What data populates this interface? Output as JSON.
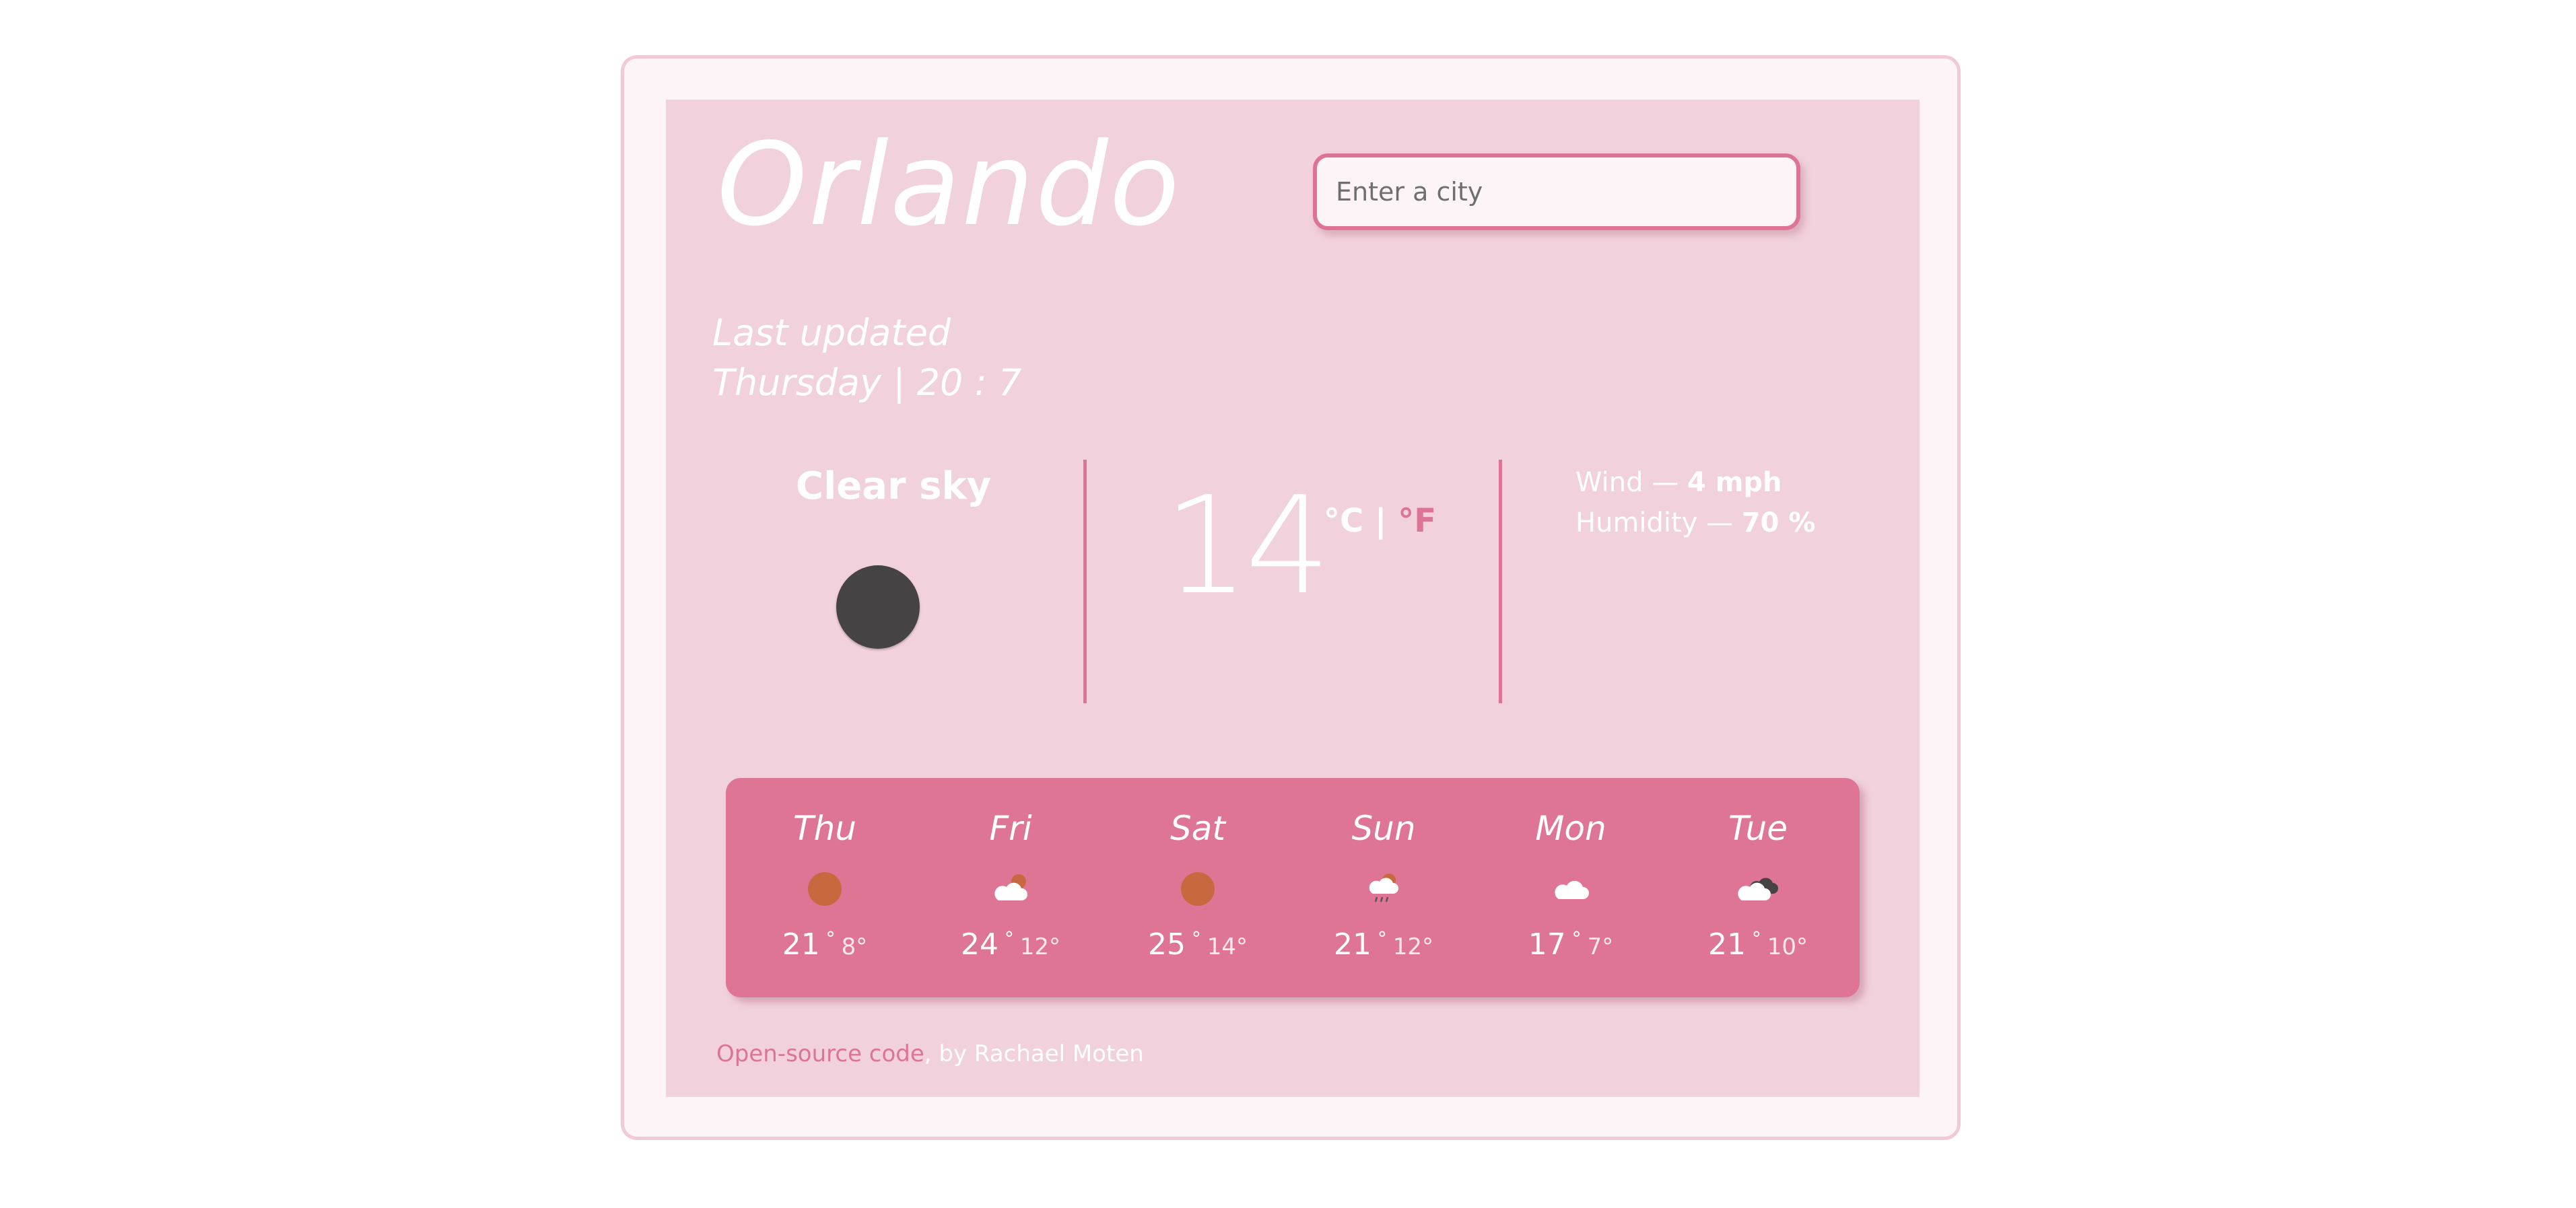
{
  "city": "Orlando",
  "search": {
    "placeholder": "Enter a city"
  },
  "updated": {
    "label": "Last updated",
    "value": "Thursday | 20 : 7"
  },
  "current": {
    "description": "Clear sky",
    "icon": "dark-circle-icon",
    "temperature": "14",
    "unit_c": "°C",
    "separator": " | ",
    "unit_f": "°F",
    "wind_label": "Wind — ",
    "wind_value": "4 mph",
    "humidity_label": "Humidity — ",
    "humidity_value": "70 %"
  },
  "forecast": [
    {
      "day": "Thu",
      "icon": "sun-icon",
      "max": "21",
      "min": "8°"
    },
    {
      "day": "Fri",
      "icon": "cloud-sun-icon",
      "max": "24",
      "min": "12°"
    },
    {
      "day": "Sat",
      "icon": "sun-icon",
      "max": "25",
      "min": "14°"
    },
    {
      "day": "Sun",
      "icon": "cloud-rain-sun-icon",
      "max": "21",
      "min": "12°"
    },
    {
      "day": "Mon",
      "icon": "cloud-icon",
      "max": "17",
      "min": "7°"
    },
    {
      "day": "Tue",
      "icon": "cloud-dark-cloud-icon",
      "max": "21",
      "min": "10°"
    }
  ],
  "footer": {
    "link_text": "Open-source code",
    "suffix": ", by Rachael Moten"
  },
  "colors": {
    "accent": "#dd7395",
    "card": "#f1d1dc",
    "outer": "#fcf4f7",
    "sun": "#c8683f"
  }
}
